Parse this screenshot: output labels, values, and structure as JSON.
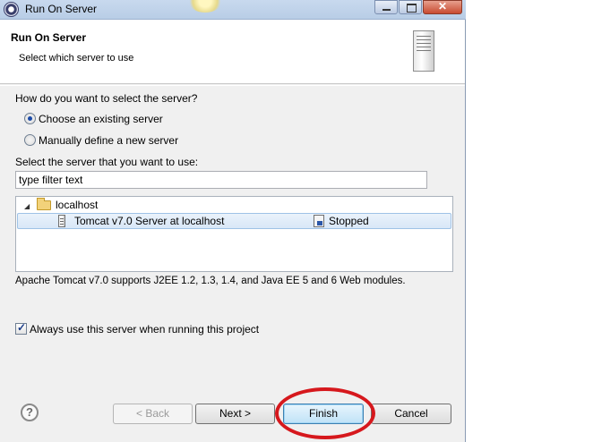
{
  "window": {
    "title": "Run On Server"
  },
  "header": {
    "title": "Run On Server",
    "description": "Select which server to use"
  },
  "selection": {
    "question": "How do you want to select the server?",
    "options": [
      {
        "label": "Choose an existing server",
        "selected": true
      },
      {
        "label": "Manually define a new server",
        "selected": false
      }
    ]
  },
  "server_list": {
    "label": "Select the server that you want to use:",
    "filter_value": "type filter text",
    "tree": {
      "group_label": "localhost",
      "rows": [
        {
          "name": "Tomcat v7.0 Server at localhost",
          "status": "Stopped",
          "selected": true
        }
      ]
    },
    "description": "Apache Tomcat v7.0 supports J2EE 1.2, 1.3, 1.4, and Java EE 5 and 6 Web modules."
  },
  "always_use": {
    "label": "Always use this server when running this project",
    "checked": true
  },
  "buttons": {
    "help": "?",
    "back": "< Back",
    "next": "Next >",
    "finish": "Finish",
    "cancel": "Cancel"
  },
  "colors": {
    "annotation_circle": "#d6181d",
    "selection_highlight": "#d8e7f7",
    "default_button": "#bfe2f7"
  },
  "icons": {
    "title": "eclipse-icon",
    "header": "server-icon",
    "folder": "folder-icon",
    "server_row": "tomcat-server-icon",
    "status": "stopped-icon"
  }
}
